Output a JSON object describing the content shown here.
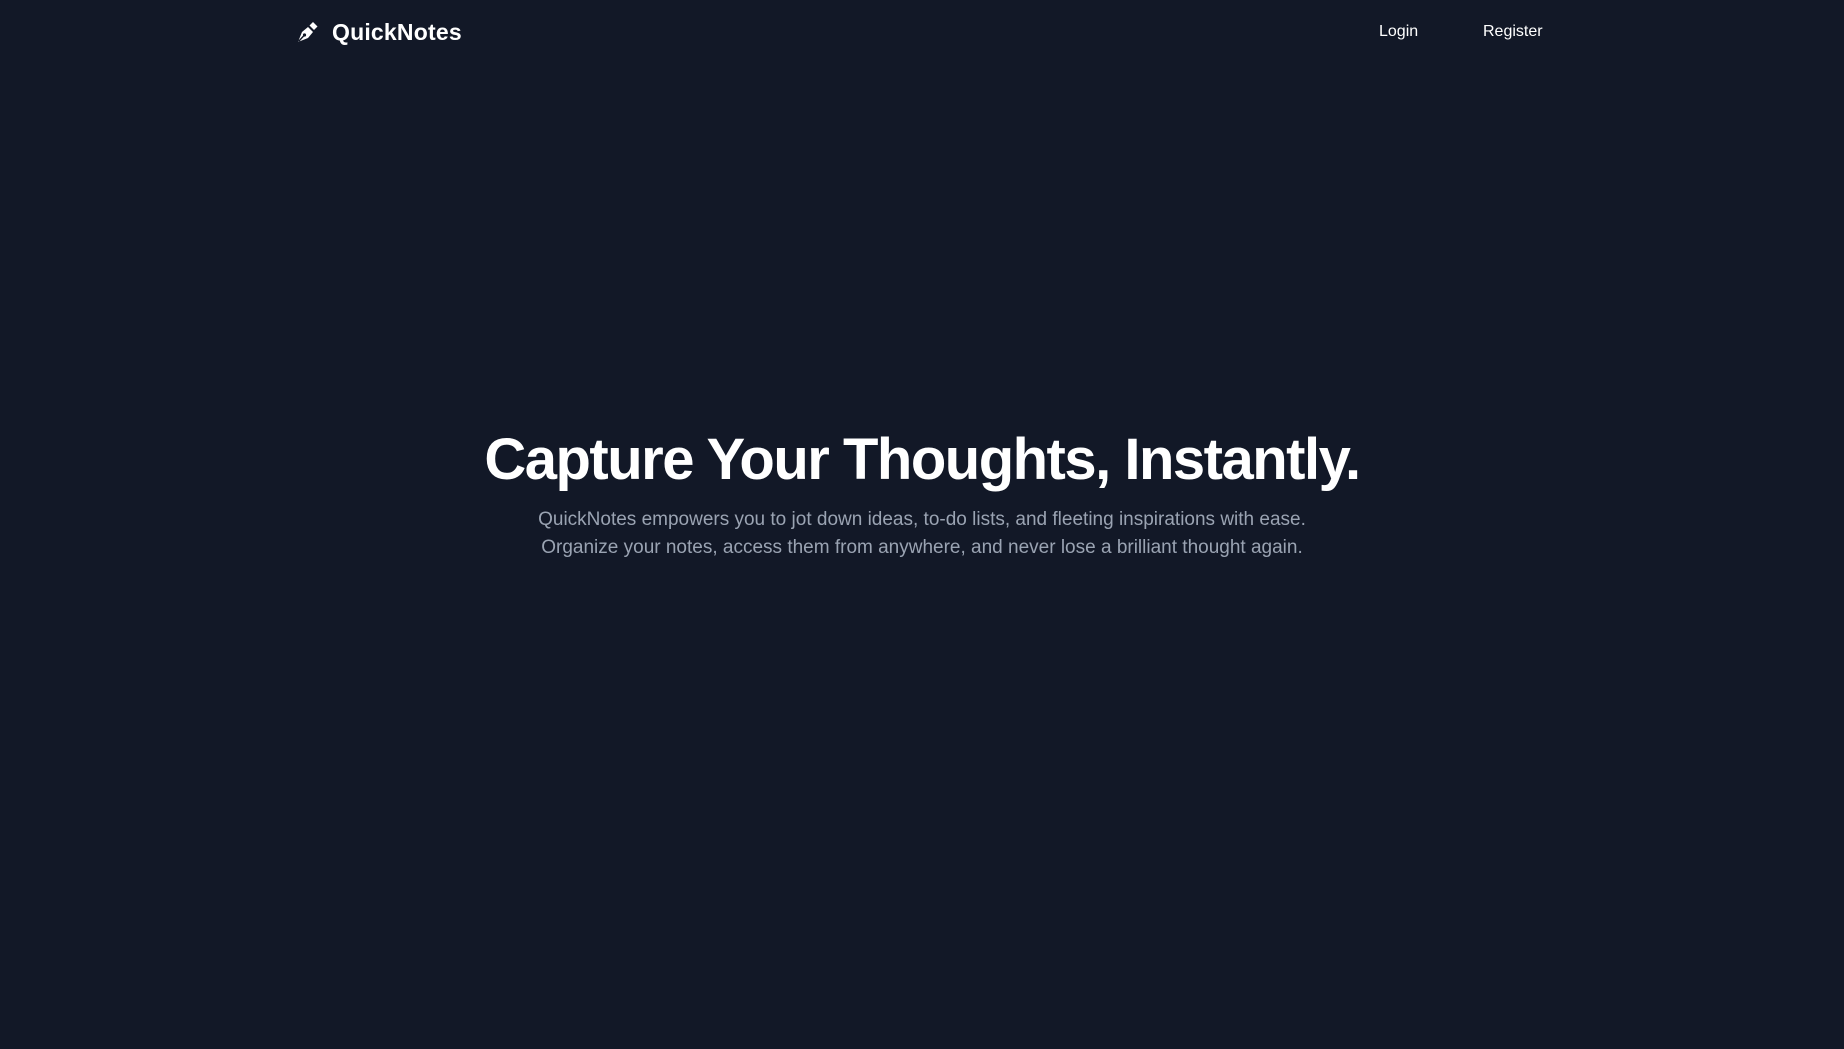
{
  "navbar": {
    "brand": {
      "icon": "fountain-pen-icon",
      "name": "QuickNotes"
    },
    "links": {
      "login": "Login",
      "register": "Register"
    }
  },
  "hero": {
    "title": "Capture Your Thoughts, Instantly.",
    "subtitle": "QuickNotes empowers you to jot down ideas, to-do lists, and fleeting inspirations with ease. Organize your notes, access them from anywhere, and never lose a brilliant thought again."
  },
  "colors": {
    "background": "#121827",
    "text": "#ffffff",
    "muted_text": "#9aa3b2"
  }
}
